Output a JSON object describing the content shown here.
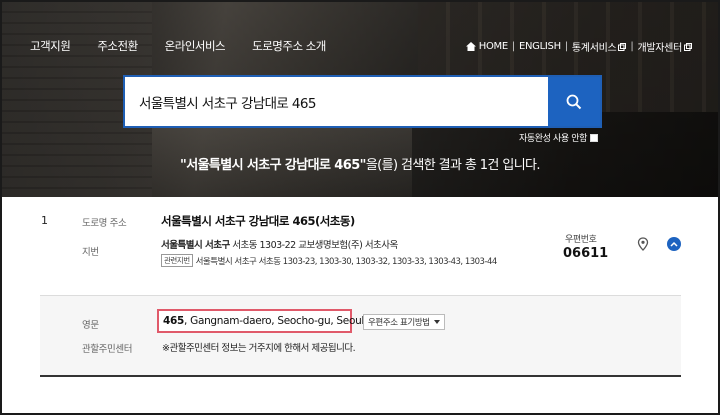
{
  "nav": {
    "left_items": [
      "고객지원",
      "주소전환",
      "온라인서비스",
      "도로명주소 소개"
    ],
    "home_label": "HOME",
    "english_label": "ENGLISH",
    "stats_label": "통계서비스",
    "dev_label": "개발자센터"
  },
  "search": {
    "value": "서울특별시 서초구 강남대로 465",
    "autocomplete_label": "자동완성 사용 안함"
  },
  "result_summary": {
    "query_quoted": "\"서울특별시 서초구 강남대로 465\"",
    "suffix": "을(를) 검색한 결과 총 1건 입니다."
  },
  "result": {
    "number": "1",
    "road_label": "도로명 주소",
    "road_address": "서울특별시 서초구 강남대로 465(서초동)",
    "jibun_label": "지번",
    "jibun_bold": "서울특별시 서초구",
    "jibun_rest": " 서초동 1303-22 교보생명보험(주) 서초사옥",
    "related_tag": "관련지번",
    "related_jibun": "서울특별시 서초구 서초동 1303-23, 1303-30, 1303-32, 1303-33, 1303-43, 1303-44",
    "zip_label": "우편번호",
    "zip_code": "06611"
  },
  "detail": {
    "english_label": "영문",
    "english_number": "465",
    "english_rest": ", Gangnam-daero, Seocho-gu, Seoul",
    "method_select": "우편주소 표기방법",
    "center_label": "관할주민센터",
    "center_note": "※관할주민센터 정보는 거주지에 한해서 제공됩니다."
  },
  "colors": {
    "accent": "#1d63c0",
    "highlight_border": "#e05a6a"
  }
}
